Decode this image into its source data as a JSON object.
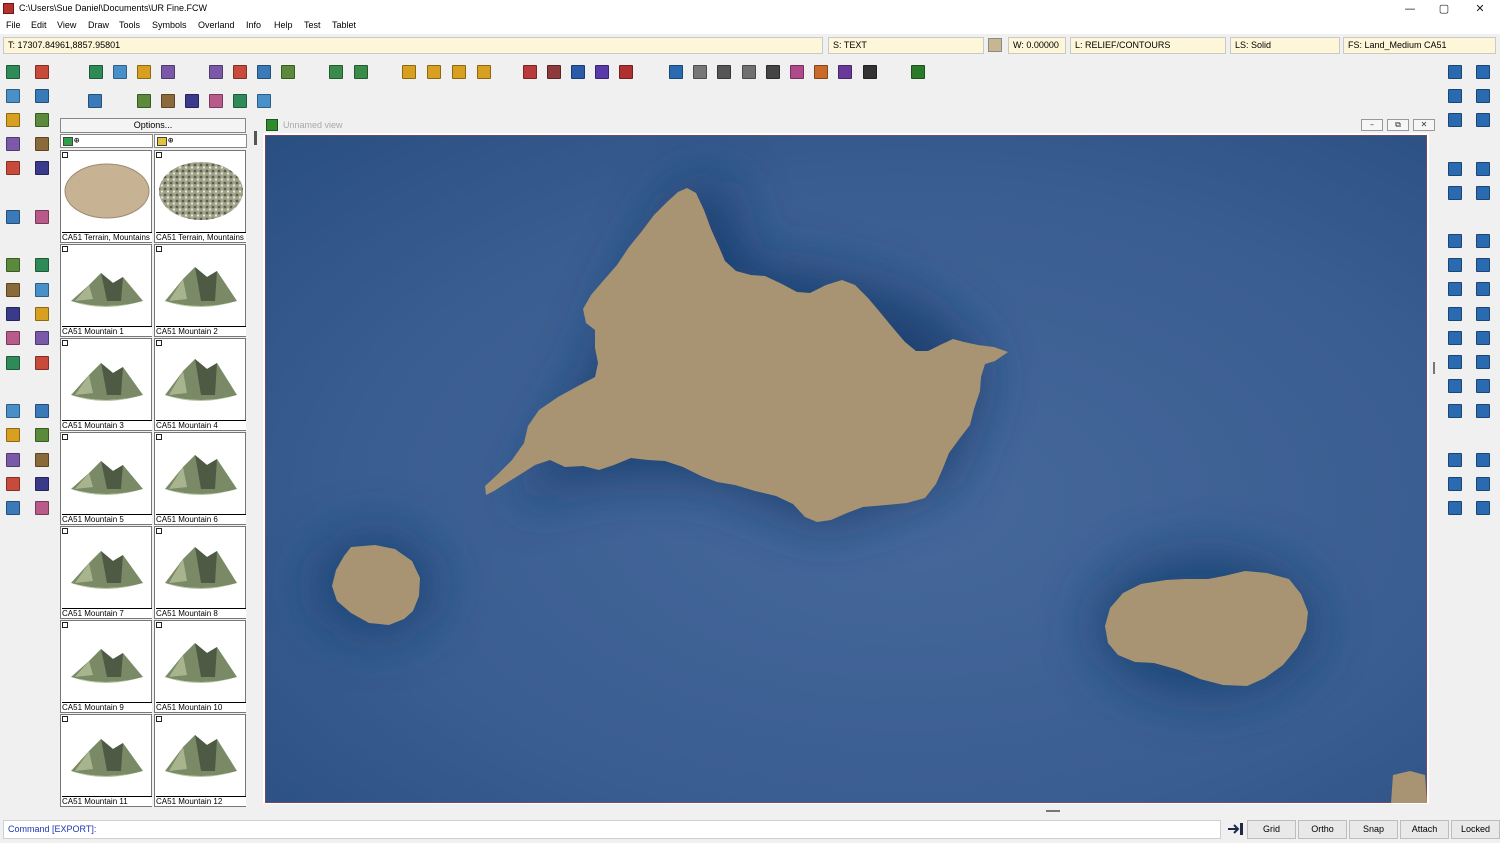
{
  "window": {
    "title": "C:\\Users\\Sue Daniel\\Documents\\UR Fine.FCW",
    "minimize_glyph": "—",
    "maximize_glyph": "▢",
    "close_glyph": "✕"
  },
  "menu": [
    "File",
    "Edit",
    "View",
    "Draw",
    "Tools",
    "Symbols",
    "Overland",
    "Info",
    "Help",
    "Test",
    "Tablet"
  ],
  "status": {
    "coords": "T: 17307.84961,8857.95801",
    "sheet": "S: TEXT",
    "width": "W: 0.00000",
    "layer": "L: RELIEF/CONTOURS",
    "line_style": "LS: Solid",
    "fill_style": "FS: Land_Medium CA51",
    "current_color": "#c8b592"
  },
  "symbol_panel": {
    "options_label": "Options...",
    "tabs": [
      {
        "icon": "folder-green-icon",
        "label": "⊕"
      },
      {
        "icon": "folder-yellow-icon",
        "label": "⊕"
      }
    ],
    "symbols": [
      {
        "name": "CA51 Terrain, Mountains",
        "kind": "blob"
      },
      {
        "name": "CA51 Terrain, Mountains",
        "kind": "rocks"
      },
      {
        "name": "CA51 Mountain 1",
        "kind": "mountain"
      },
      {
        "name": "CA51 Mountain 2",
        "kind": "mountain"
      },
      {
        "name": "CA51 Mountain 3",
        "kind": "mountain"
      },
      {
        "name": "CA51 Mountain 4",
        "kind": "mountain"
      },
      {
        "name": "CA51 Mountain 5",
        "kind": "mountain"
      },
      {
        "name": "CA51 Mountain 6",
        "kind": "mountain"
      },
      {
        "name": "CA51 Mountain 7",
        "kind": "mountain"
      },
      {
        "name": "CA51 Mountain 8",
        "kind": "mountain"
      },
      {
        "name": "CA51 Mountain 9",
        "kind": "mountain"
      },
      {
        "name": "CA51 Mountain 10",
        "kind": "mountain"
      },
      {
        "name": "CA51 Mountain 11",
        "kind": "mountain"
      },
      {
        "name": "CA51 Mountain 12",
        "kind": "mountain"
      }
    ]
  },
  "map_view": {
    "title": "Unnamed view",
    "sea_color": "#2f5889",
    "land_color": "#a89472",
    "controls": [
      "–",
      "⧉",
      "✕"
    ]
  },
  "command": {
    "text": "Command [EXPORT]:",
    "toggles": [
      "Grid",
      "Ortho",
      "Snap",
      "Attach",
      "Locked"
    ]
  },
  "toolbars": {
    "file_tools": [
      "new-drawing-icon",
      "open-folder-icon",
      "save-icon",
      "print-icon"
    ],
    "edit_tools": [
      "zoom-file-icon",
      "note-icon",
      "document-edit-icon",
      "document-check-icon"
    ],
    "nav_tools": [
      "move-left-icon",
      "move-right-icon"
    ],
    "catalog_tools": [
      "catalog-book-icon",
      "catalog-import-icon",
      "catalog-export-icon",
      "catalog-folder-icon"
    ],
    "style_swatches": [
      "#b83a3a",
      "#8c3a3a",
      "#2a5aa8",
      "#5a3aa8",
      "#b03030",
      "#2a6ab0",
      "#777777",
      "#555555",
      "#707070",
      "#444444",
      "#b04a8a",
      "#c86a2a",
      "#6a3a9a",
      "#333333",
      "#2a7a2a"
    ],
    "row2_tools": [
      "properties-icon",
      "flag-icon",
      "ship-icon",
      "village-icon",
      "quill-icon",
      "pot-icon",
      "tree-icon"
    ],
    "left_col1": [
      "map-green-icon",
      "scatter-icon",
      "slope-icon",
      "grid-icon",
      "tools-icon",
      "search-map-icon",
      "undo-icon",
      "eraser-icon",
      "node-edit-icon",
      "rotate-icon",
      "explode-icon",
      "trim-icon",
      "export-icon",
      "import-icon",
      "frame-icon",
      "line-icon"
    ],
    "left_col2": [
      "map-blue-icon",
      "terrain-icon",
      "layers-icon",
      "wrench-icon",
      "pins-icon",
      "notes-yellow-icon",
      "eyedropper-icon",
      "paint-icon",
      "group-icon",
      "mirror-icon",
      "distribute-icon",
      "text-replace-icon",
      "xy-icon",
      "align-icon",
      "rect-icon",
      "intersect-icon"
    ],
    "right_col1": [
      "zoom-window-icon",
      "zoom-extents-icon",
      "redraw-icon",
      "copy-icon",
      "duplicate-icon",
      "line-tool-icon",
      "freehand-icon",
      "arc-icon",
      "path-icon",
      "curve-icon",
      "polyline-icon",
      "number-icon",
      "text-a-icon",
      "snap-line-icon",
      "snap-angle-icon",
      "snap-perp-icon"
    ],
    "right_col2": [
      "zoom-in-icon",
      "zoom-out-icon",
      "zoom-search-icon",
      "stack-icon",
      "stack-blue-icon",
      "rectangle-icon",
      "polygon-icon",
      "circle-icon",
      "shape-icon",
      "blob-icon",
      "sparkle-icon",
      "lock-shape-icon",
      "text-box-icon",
      "snap-end-icon",
      "snap-cross-icon",
      "snap-center-icon"
    ]
  }
}
